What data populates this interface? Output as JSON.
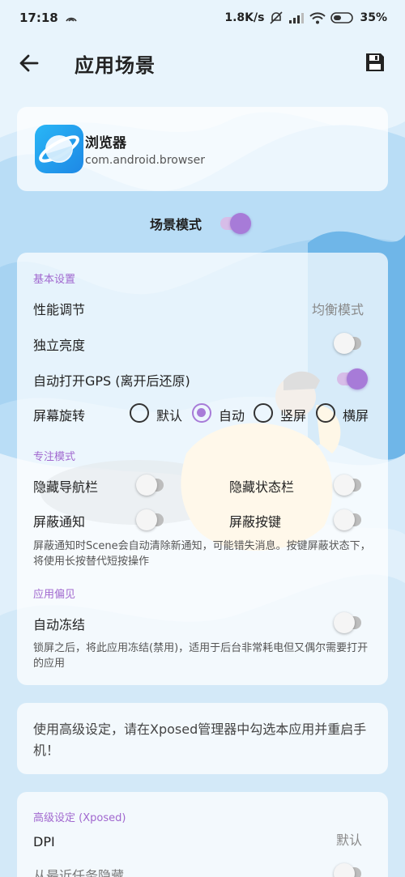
{
  "status_bar": {
    "time": "17:18",
    "net_speed": "1.8K/s",
    "battery": "35%"
  },
  "header": {
    "title": "应用场景",
    "back_icon": "arrow-left-icon",
    "save_icon": "floppy-disk-icon"
  },
  "app": {
    "name": "浏览器",
    "package": "com.android.browser",
    "icon": "browser-planet-icon"
  },
  "scene_mode": {
    "label": "场景模式",
    "on": true
  },
  "basic": {
    "section_title": "基本设置",
    "performance_label": "性能调节",
    "performance_value": "均衡模式",
    "brightness_label": "独立亮度",
    "brightness_on": false,
    "gps_label": "自动打开GPS (离开后还原)",
    "gps_on": true,
    "rotation_label": "屏幕旋转",
    "rotation_options": [
      "默认",
      "自动",
      "竖屏",
      "横屏"
    ],
    "rotation_selected": "自动"
  },
  "focus": {
    "section_title": "专注模式",
    "hide_nav_label": "隐藏导航栏",
    "hide_status_label": "隐藏状态栏",
    "block_notify_label": "屏蔽通知",
    "block_keys_label": "屏蔽按键",
    "description": "屏蔽通知时Scene会自动清除新通知，可能错失消息。按键屏蔽状态下，将使用长按替代短按操作"
  },
  "preference": {
    "section_title": "应用偏见",
    "freeze_label": "自动冻结",
    "description": "锁屏之后，将此应用冻结(禁用)，适用于后台非常耗电但又偶尔需要打开的应用"
  },
  "notice": {
    "text": "使用高级设定，请在Xposed管理器中勾选本应用并重启手机！"
  },
  "advanced": {
    "section_title": "高级设定 (Xposed)",
    "dpi_label": "DPI",
    "dpi_value": "默认",
    "hide_recent_label": "从最近任务隐藏"
  },
  "colors": {
    "accent": "#a77bd8",
    "section_title": "#a168cf",
    "background": "#d9edfb"
  }
}
